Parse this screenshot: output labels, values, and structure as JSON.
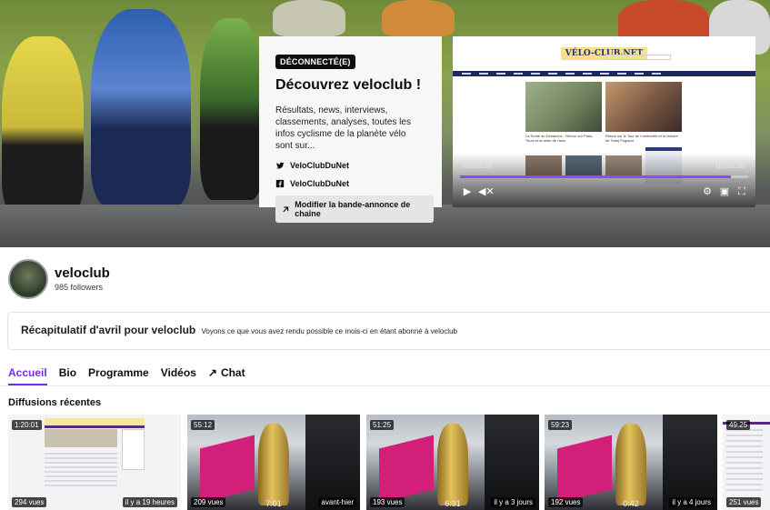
{
  "info_card": {
    "status_badge": "DÉCONNECTÉ(E)",
    "title": "Découvrez veloclub !",
    "description": "Résultats, news, interviews, classements, analyses, toutes les infos cyclisme de la planète vélo sont sur...",
    "socials": [
      {
        "icon": "twitter-icon",
        "label": "VeloClubDuNet"
      },
      {
        "icon": "facebook-icon",
        "label": "VeloClubDuNet"
      }
    ],
    "edit_trailer_label": "Modifier la bande-annonce de chaîne"
  },
  "player": {
    "site_logo": "VÉLO-CLUB.NET",
    "article_a_title": "La Sortie du Dimanche - Retour sur Paris-Tours et la reste de l'actu",
    "article_b_title": "Retour sur le Tour de Lombardie et la victoire de Tadej Pogacar",
    "current_time": "00:00:28",
    "total_time": "00:00:28",
    "progress": 0.94
  },
  "channel": {
    "name": "veloclub",
    "followers": "985 followers"
  },
  "recap": {
    "title": "Récapitulatif d'avril pour veloclub",
    "text": "Voyons ce que vous avez rendu possible ce mois-ci en étant abonné à veloclub"
  },
  "tabs": [
    {
      "label": "Accueil",
      "active": true
    },
    {
      "label": "Bio"
    },
    {
      "label": "Programme"
    },
    {
      "label": "Vidéos"
    },
    {
      "label": "Chat",
      "icon": "external-arrow-icon"
    }
  ],
  "section_title": "Diffusions récentes",
  "videos": [
    {
      "duration": "1:20:01",
      "views": "294 vues",
      "when": "il y a 19 heures",
      "clip_time": ""
    },
    {
      "duration": "55:12",
      "views": "209 vues",
      "when": "avant-hier",
      "clip_time": "7:01"
    },
    {
      "duration": "51:25",
      "views": "193 vues",
      "when": "il y a 3 jours",
      "clip_time": "6:31"
    },
    {
      "duration": "59:23",
      "views": "192 vues",
      "when": "il y a 4 jours",
      "clip_time": "0:42"
    },
    {
      "duration": "49:25",
      "views": "251 vues",
      "when": "",
      "clip_time": ""
    }
  ],
  "colors": {
    "accent": "#772ce8",
    "progress": "#9147ff",
    "badge_bg": "#0e0e10"
  }
}
